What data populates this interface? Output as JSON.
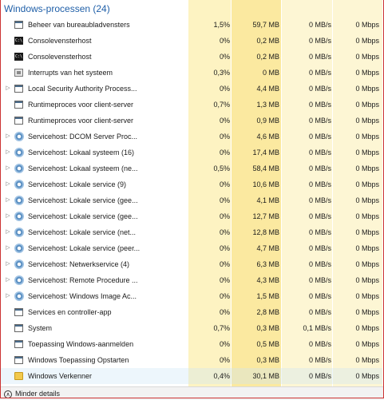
{
  "group": {
    "title": "Windows-processen (24)"
  },
  "processes": [
    {
      "name": "Beheer van bureaubladvensters",
      "cpu": "1,5%",
      "memory": "59,7 MB",
      "disk": "0 MB/s",
      "network": "0 Mbps",
      "icon": "window-icon",
      "expandable": false
    },
    {
      "name": "Consolevensterhost",
      "cpu": "0%",
      "memory": "0,2 MB",
      "disk": "0 MB/s",
      "network": "0 Mbps",
      "icon": "console-icon",
      "expandable": false
    },
    {
      "name": "Consolevensterhost",
      "cpu": "0%",
      "memory": "0,2 MB",
      "disk": "0 MB/s",
      "network": "0 Mbps",
      "icon": "console-icon",
      "expandable": false
    },
    {
      "name": "Interrupts van het systeem",
      "cpu": "0,3%",
      "memory": "0 MB",
      "disk": "0 MB/s",
      "network": "0 Mbps",
      "icon": "chip-icon",
      "expandable": false
    },
    {
      "name": "Local Security Authority Process...",
      "cpu": "0%",
      "memory": "4,4 MB",
      "disk": "0 MB/s",
      "network": "0 Mbps",
      "icon": "window-icon",
      "expandable": true
    },
    {
      "name": "Runtimeproces voor client-server",
      "cpu": "0,7%",
      "memory": "1,3 MB",
      "disk": "0 MB/s",
      "network": "0 Mbps",
      "icon": "window-icon",
      "expandable": false
    },
    {
      "name": "Runtimeproces voor client-server",
      "cpu": "0%",
      "memory": "0,9 MB",
      "disk": "0 MB/s",
      "network": "0 Mbps",
      "icon": "window-icon",
      "expandable": false
    },
    {
      "name": "Servicehost: DCOM Server Proc...",
      "cpu": "0%",
      "memory": "4,6 MB",
      "disk": "0 MB/s",
      "network": "0 Mbps",
      "icon": "gear-icon",
      "expandable": true
    },
    {
      "name": "Servicehost: Lokaal systeem (16)",
      "cpu": "0%",
      "memory": "17,4 MB",
      "disk": "0 MB/s",
      "network": "0 Mbps",
      "icon": "gear-icon",
      "expandable": true
    },
    {
      "name": "Servicehost: Lokaal systeem (ne...",
      "cpu": "0,5%",
      "memory": "58,4 MB",
      "disk": "0 MB/s",
      "network": "0 Mbps",
      "icon": "gear-icon",
      "expandable": true
    },
    {
      "name": "Servicehost: Lokale service (9)",
      "cpu": "0%",
      "memory": "10,6 MB",
      "disk": "0 MB/s",
      "network": "0 Mbps",
      "icon": "gear-icon",
      "expandable": true
    },
    {
      "name": "Servicehost: Lokale service (gee...",
      "cpu": "0%",
      "memory": "4,1 MB",
      "disk": "0 MB/s",
      "network": "0 Mbps",
      "icon": "gear-icon",
      "expandable": true
    },
    {
      "name": "Servicehost: Lokale service (gee...",
      "cpu": "0%",
      "memory": "12,7 MB",
      "disk": "0 MB/s",
      "network": "0 Mbps",
      "icon": "gear-icon",
      "expandable": true
    },
    {
      "name": "Servicehost: Lokale service (net...",
      "cpu": "0%",
      "memory": "12,8 MB",
      "disk": "0 MB/s",
      "network": "0 Mbps",
      "icon": "gear-icon",
      "expandable": true
    },
    {
      "name": "Servicehost: Lokale service (peer...",
      "cpu": "0%",
      "memory": "4,7 MB",
      "disk": "0 MB/s",
      "network": "0 Mbps",
      "icon": "gear-icon",
      "expandable": true
    },
    {
      "name": "Servicehost: Netwerkservice (4)",
      "cpu": "0%",
      "memory": "6,3 MB",
      "disk": "0 MB/s",
      "network": "0 Mbps",
      "icon": "gear-icon",
      "expandable": true
    },
    {
      "name": "Servicehost: Remote Procedure ...",
      "cpu": "0%",
      "memory": "4,3 MB",
      "disk": "0 MB/s",
      "network": "0 Mbps",
      "icon": "gear-icon",
      "expandable": true
    },
    {
      "name": "Servicehost: Windows Image Ac...",
      "cpu": "0%",
      "memory": "1,5 MB",
      "disk": "0 MB/s",
      "network": "0 Mbps",
      "icon": "gear-icon",
      "expandable": true
    },
    {
      "name": "Services en controller-app",
      "cpu": "0%",
      "memory": "2,8 MB",
      "disk": "0 MB/s",
      "network": "0 Mbps",
      "icon": "window-icon",
      "expandable": false
    },
    {
      "name": "System",
      "cpu": "0,7%",
      "memory": "0,3 MB",
      "disk": "0,1 MB/s",
      "network": "0 Mbps",
      "icon": "window-icon",
      "expandable": false
    },
    {
      "name": "Toepassing Windows-aanmelden",
      "cpu": "0%",
      "memory": "0,5 MB",
      "disk": "0 MB/s",
      "network": "0 Mbps",
      "icon": "window-icon",
      "expandable": false
    },
    {
      "name": "Windows Toepassing Opstarten",
      "cpu": "0%",
      "memory": "0,3 MB",
      "disk": "0 MB/s",
      "network": "0 Mbps",
      "icon": "window-icon",
      "expandable": false
    },
    {
      "name": "Windows Verkenner",
      "cpu": "0,4%",
      "memory": "30,1 MB",
      "disk": "0 MB/s",
      "network": "0 Mbps",
      "icon": "folder-icon",
      "expandable": false,
      "selected": true
    }
  ],
  "footer": {
    "less_details_label": "Minder details",
    "icon": "chevron-up-icon"
  },
  "colors": {
    "cpu_column": "#fdf3c2",
    "memory_column": "#fbe9a0",
    "disk_column": "#fdf6d4",
    "network_column": "#fdf6d4",
    "group_title": "#1f5fa8",
    "selected_row": "#cce4f7"
  }
}
